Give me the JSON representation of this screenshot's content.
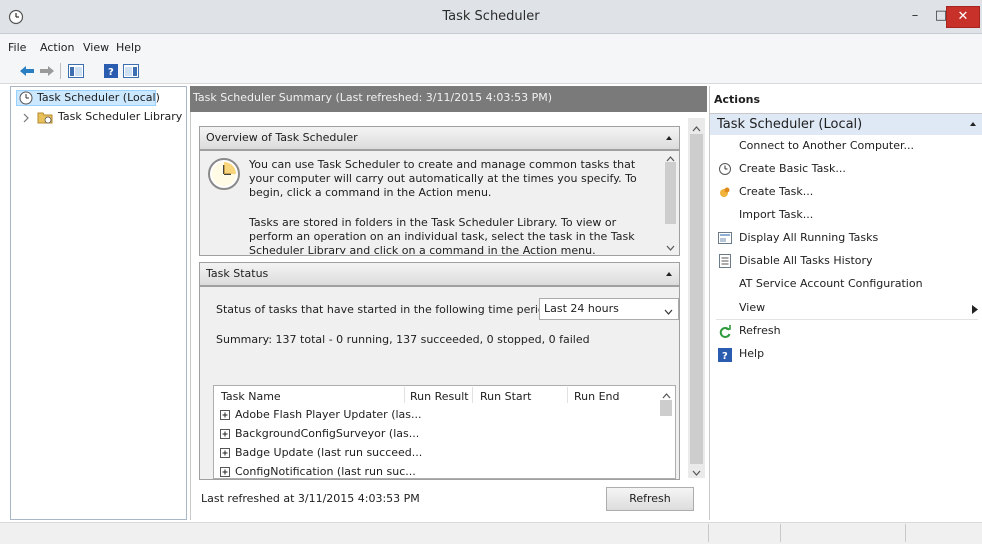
{
  "window": {
    "title": "Task Scheduler",
    "minimize": "–",
    "maximize": "□",
    "close": "✕"
  },
  "menu": [
    "File",
    "Action",
    "View",
    "Help"
  ],
  "tree": {
    "root": "Task Scheduler (Local)",
    "child": "Task Scheduler Library"
  },
  "summary": {
    "header": "Task Scheduler Summary (Last refreshed: 3/11/2015 4:03:53 PM)",
    "overview": {
      "title": "Overview of Task Scheduler",
      "para1": "You can use Task Scheduler to create and manage common tasks that your computer will carry out automatically at the times you specify. To begin, click a command in the Action menu.",
      "para2": "Tasks are stored in folders in the Task Scheduler Library. To view or perform an operation on an individual task, select the task in the Task Scheduler Library and click on a command in the Action menu."
    },
    "status": {
      "title": "Task Status",
      "period_label": "Status of tasks that have started in the following time period:",
      "period_value": "Last 24 hours",
      "summary": "Summary: 137 total - 0 running, 137 succeeded, 0 stopped, 0 failed",
      "columns": [
        "Task Name",
        "Run Result",
        "Run Start",
        "Run End"
      ],
      "rows": [
        "Adobe Flash Player Updater (las...",
        "BackgroundConfigSurveyor (las...",
        "Badge Update (last run succeed...",
        "ConfigNotification (last run suc..."
      ]
    },
    "footer": {
      "last_refreshed": "Last refreshed at 3/11/2015 4:03:53 PM",
      "refresh_button": "Refresh"
    }
  },
  "actions": {
    "header": "Actions",
    "group": "Task Scheduler (Local)",
    "items": [
      {
        "label": "Connect to Another Computer...",
        "icon": "none"
      },
      {
        "label": "Create Basic Task...",
        "icon": "basic-task-icon"
      },
      {
        "label": "Create Task...",
        "icon": "create-task-icon"
      },
      {
        "label": "Import Task...",
        "icon": "none"
      },
      {
        "label": "Display All Running Tasks",
        "icon": "running-tasks-icon"
      },
      {
        "label": "Disable All Tasks History",
        "icon": "history-icon"
      },
      {
        "label": "AT Service Account Configuration",
        "icon": "none"
      },
      {
        "label": "View",
        "icon": "none"
      },
      {
        "label": "Refresh",
        "icon": "refresh-icon"
      },
      {
        "label": "Help",
        "icon": "help-icon"
      }
    ]
  },
  "colors": {
    "accent": "#c7312a",
    "header_gray": "#7a7a7a",
    "selection": "#cce8ff"
  }
}
